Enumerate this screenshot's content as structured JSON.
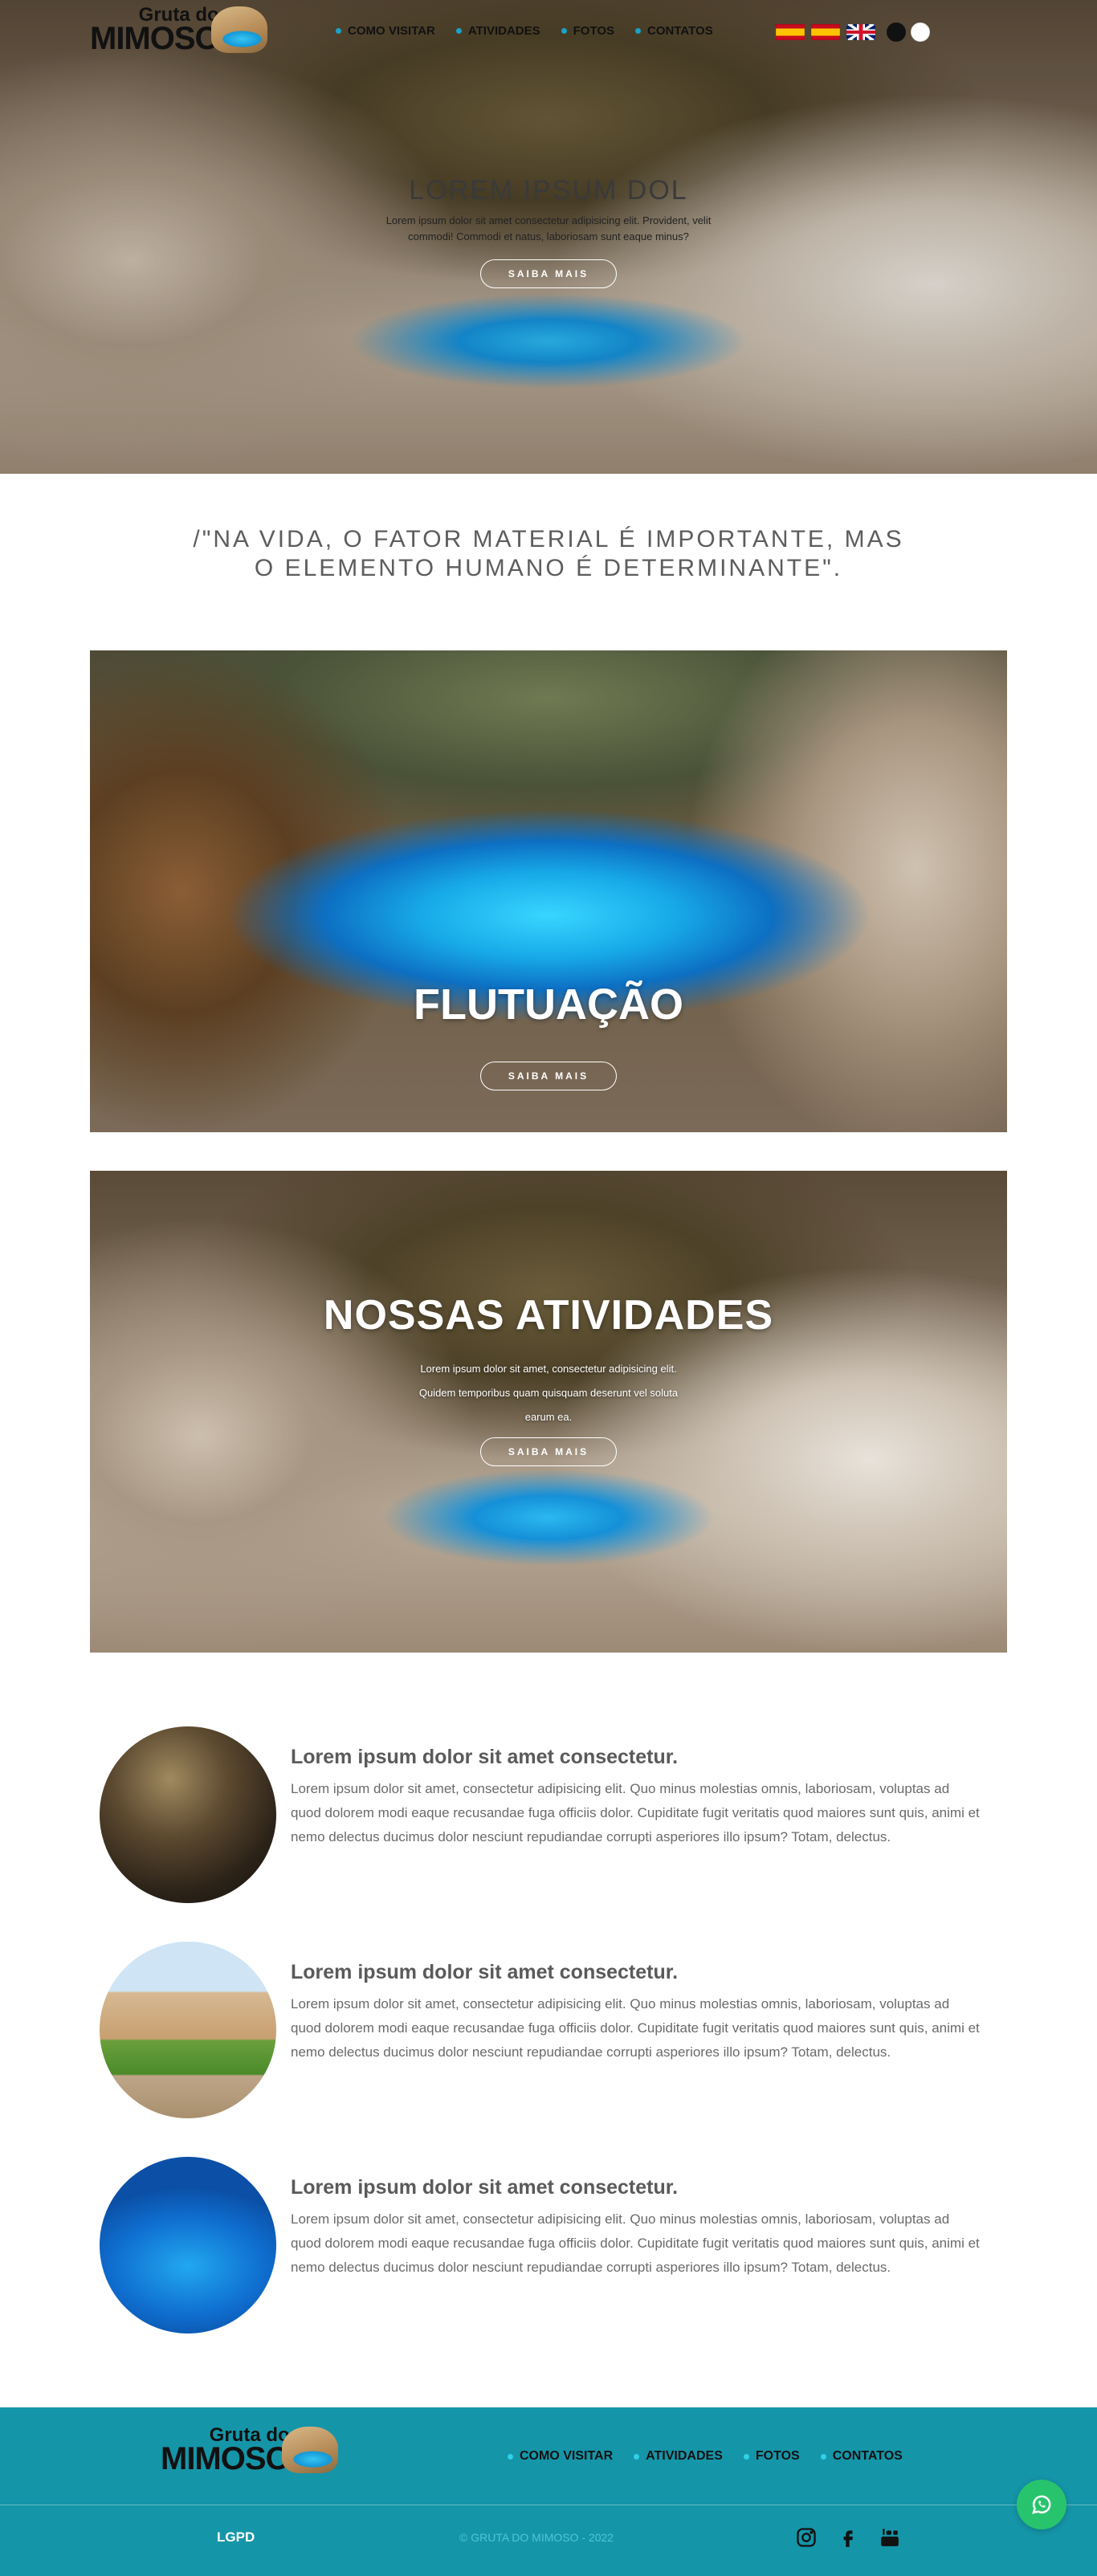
{
  "brand": {
    "logo_small": "Gruta do",
    "logo_big": "MIMOSO"
  },
  "nav": {
    "items": [
      {
        "label": "COMO VISITAR"
      },
      {
        "label": "ATIVIDADES"
      },
      {
        "label": "FOTOS"
      },
      {
        "label": "CONTATOS"
      }
    ]
  },
  "languages": [
    {
      "icon": "spanish-flag-icon"
    },
    {
      "icon": "spanish-flag-icon"
    },
    {
      "icon": "uk-flag-icon"
    }
  ],
  "theme_toggle": {
    "colors": [
      "#111111",
      "#ffffff"
    ]
  },
  "hero": {
    "title": "LOREM IPSUM DOL",
    "subtitle": "Lorem ipsum dolor sit amet consectetur adipisicing elit. Provident, velit commodi! Commodi et natus, laboriosam sunt eaque minus?",
    "button": "SAIBA MAIS"
  },
  "quote": "/\"NA VIDA, O FATOR MATERIAL É IMPORTANTE, MAS O ELEMENTO HUMANO É DETERMINANTE\".",
  "features": [
    {
      "title": "FLUTUAÇÃO",
      "button": "SAIBA MAIS"
    },
    {
      "title": "NOSSAS ATIVIDADES",
      "text": "Lorem ipsum dolor sit amet, consectetur adipisicing elit. Quidem temporibus quam quisquam deserunt vel soluta earum ea.",
      "button": "SAIBA MAIS"
    }
  ],
  "info": [
    {
      "title": "Lorem ipsum dolor sit amet consectetur.",
      "text": "Lorem ipsum dolor sit amet, consectetur adipisicing elit. Quo minus molestias omnis, laboriosam, voluptas ad quod dolorem modi eaque recusandae fuga officiis dolor. Cupiditate fugit veritatis quod maiores sunt quis, animi et nemo delectus ducimus dolor nesciunt repudiandae corrupti asperiores illo ipsum? Totam, delectus."
    },
    {
      "title": "Lorem ipsum dolor sit amet consectetur.",
      "text": "Lorem ipsum dolor sit amet, consectetur adipisicing elit. Quo minus molestias omnis, laboriosam, voluptas ad quod dolorem modi eaque recusandae fuga officiis dolor. Cupiditate fugit veritatis quod maiores sunt quis, animi et nemo delectus ducimus dolor nesciunt repudiandae corrupti asperiores illo ipsum? Totam, delectus."
    },
    {
      "title": "Lorem ipsum dolor sit amet consectetur.",
      "text": "Lorem ipsum dolor sit amet, consectetur adipisicing elit. Quo minus molestias omnis, laboriosam, voluptas ad quod dolorem modi eaque recusandae fuga officiis dolor. Cupiditate fugit veritatis quod maiores sunt quis, animi et nemo delectus ducimus dolor nesciunt repudiandae corrupti asperiores illo ipsum? Totam, delectus."
    }
  ],
  "footer": {
    "nav": [
      {
        "label": "COMO VISITAR"
      },
      {
        "label": "ATIVIDADES"
      },
      {
        "label": "FOTOS"
      },
      {
        "label": "CONTATOS"
      }
    ],
    "lgpd": "LGPD",
    "copyright": "© GRUTA DO MIMOSO - 2022",
    "social": [
      "instagram-icon",
      "facebook-icon",
      "youtube-icon"
    ]
  },
  "colors": {
    "accent": "#1595a8",
    "nav_dot": "#1aa2c8",
    "whatsapp": "#28c46d"
  },
  "whatsapp": {
    "icon": "whatsapp-icon"
  }
}
